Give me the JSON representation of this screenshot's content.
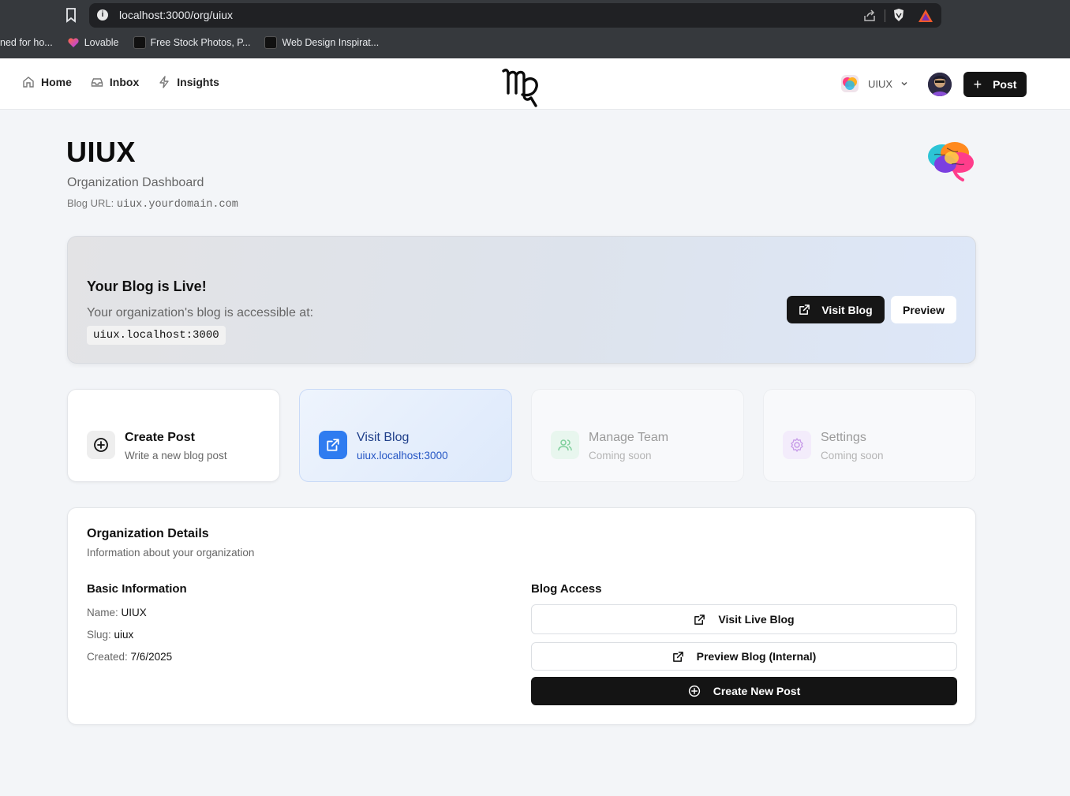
{
  "browser": {
    "url": "localhost:3000/org/uiux",
    "bookmarks": [
      {
        "label": "ned for ho...",
        "icon": "none"
      },
      {
        "label": "Lovable",
        "icon": "lovable-heart-icon"
      },
      {
        "label": "Free Stock Photos, P...",
        "icon": "pexels-icon"
      },
      {
        "label": "Web Design Inspirat...",
        "icon": "awwwards-icon"
      }
    ]
  },
  "header": {
    "nav": [
      {
        "label": "Home",
        "icon": "home-icon"
      },
      {
        "label": "Inbox",
        "icon": "inbox-icon"
      },
      {
        "label": "Insights",
        "icon": "zap-icon"
      }
    ],
    "logo": "virgo-logo-icon",
    "org_name": "UIUX",
    "post_label": "Post"
  },
  "page": {
    "title": "UIUX",
    "subtitle": "Organization Dashboard",
    "blog_url_label": "Blog URL:",
    "blog_url_value": "uiux.yourdomain.com"
  },
  "live_banner": {
    "title": "Your Blog is Live!",
    "text": "Your organization's blog is accessible at:",
    "address": "uiux.localhost:3000",
    "visit_label": "Visit Blog",
    "preview_label": "Preview"
  },
  "cards": [
    {
      "title": "Create Post",
      "subtitle": "Write a new blog post",
      "icon": "plus-circle-icon"
    },
    {
      "title": "Visit Blog",
      "subtitle": "uiux.localhost:3000",
      "icon": "external-link-icon"
    },
    {
      "title": "Manage Team",
      "subtitle": "Coming soon",
      "icon": "users-icon"
    },
    {
      "title": "Settings",
      "subtitle": "Coming soon",
      "icon": "gear-icon"
    }
  ],
  "details": {
    "title": "Organization Details",
    "subtitle": "Information about your organization",
    "basic_heading": "Basic Information",
    "name_label": "Name:",
    "name_value": "UIUX",
    "slug_label": "Slug:",
    "slug_value": "uiux",
    "created_label": "Created:",
    "created_value": "7/6/2025",
    "access_heading": "Blog Access",
    "visit_live_label": "Visit Live Blog",
    "preview_internal_label": "Preview Blog (Internal)",
    "create_new_label": "Create New Post"
  },
  "colors": {
    "accent_dark": "#141414",
    "blue_card": "#2f7cf0",
    "browser_chrome": "#36393d"
  }
}
